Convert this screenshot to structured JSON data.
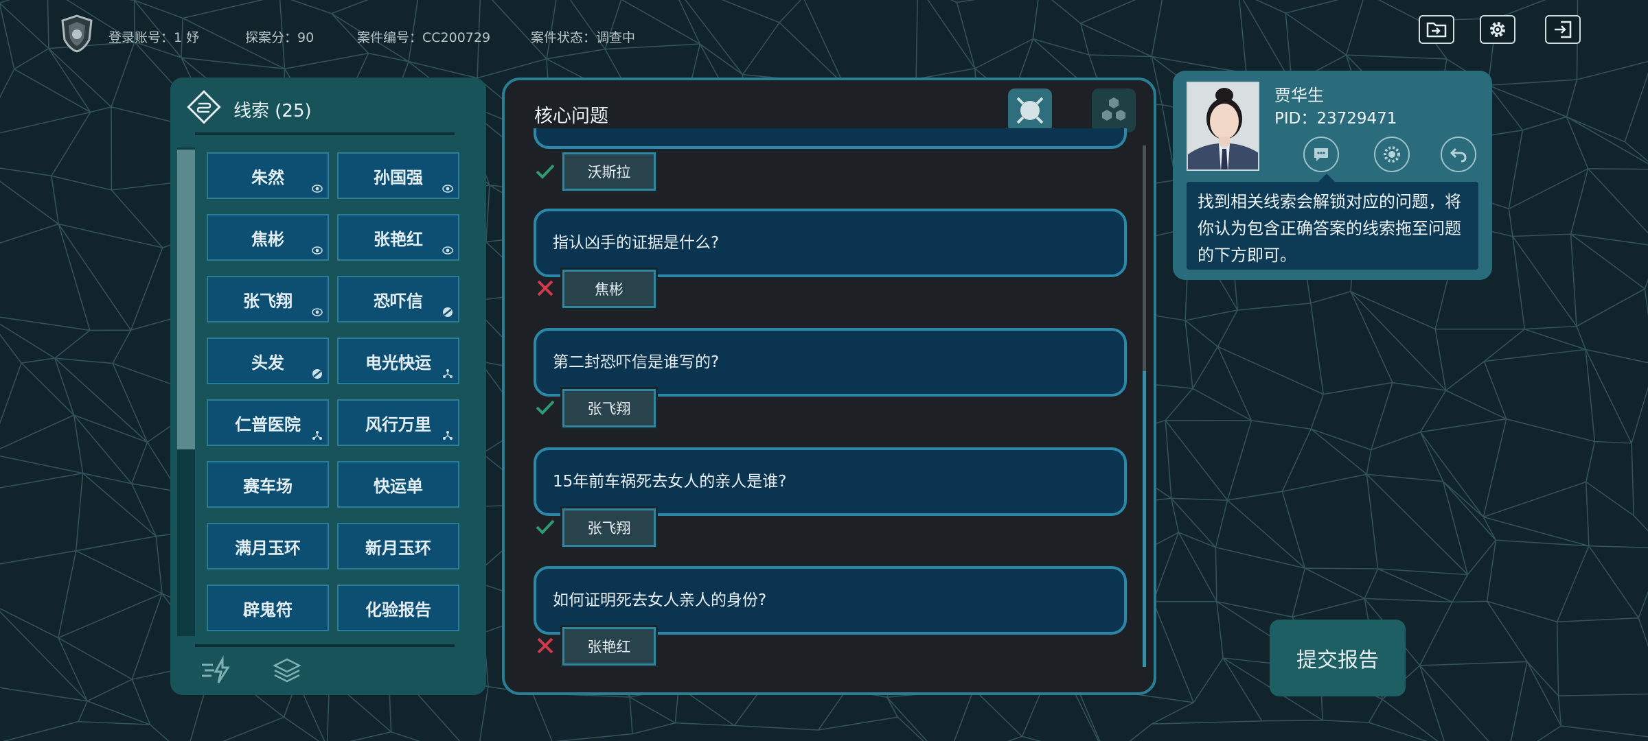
{
  "topbar": {
    "account": "登录账号：1 妤",
    "score": "探案分：90",
    "case_no": "案件编号：CC200729",
    "status": "案件状态：调查中"
  },
  "clues": {
    "title": "线索 (25)",
    "items": [
      {
        "label": "朱然",
        "badge": "eye"
      },
      {
        "label": "孙国强",
        "badge": "eye"
      },
      {
        "label": "焦彬",
        "badge": "eye"
      },
      {
        "label": "张艳红",
        "badge": "eye"
      },
      {
        "label": "张飞翔",
        "badge": "eye"
      },
      {
        "label": "恐吓信",
        "badge": "disc"
      },
      {
        "label": "头发",
        "badge": "disc"
      },
      {
        "label": "电光快运",
        "badge": "network"
      },
      {
        "label": "仁普医院",
        "badge": "network"
      },
      {
        "label": "风行万里",
        "badge": "network"
      },
      {
        "label": "赛车场",
        "badge": ""
      },
      {
        "label": "快运单",
        "badge": ""
      },
      {
        "label": "满月玉环",
        "badge": ""
      },
      {
        "label": "新月玉环",
        "badge": ""
      },
      {
        "label": "辟鬼符",
        "badge": ""
      },
      {
        "label": "化验报告",
        "badge": ""
      }
    ]
  },
  "questions": {
    "title": "核心问题",
    "partial_answer": {
      "answer": "沃斯拉",
      "correct": true
    },
    "items": [
      {
        "question": "指认凶手的证据是什么?",
        "answer": "焦彬",
        "correct": false
      },
      {
        "question": "第二封恐吓信是谁写的?",
        "answer": "张飞翔",
        "correct": true
      },
      {
        "question": "15年前车祸死去女人的亲人是谁?",
        "answer": "张飞翔",
        "correct": true
      },
      {
        "question": "如何证明死去女人亲人的身份?",
        "answer": "张艳红",
        "correct": false
      }
    ]
  },
  "character": {
    "name": "贾华生",
    "pid": "PID：23729471",
    "tip": "找到相关线索会解锁对应的问题，将你认为包含正确答案的线索拖至问题的下方即可。"
  },
  "submit_label": "提交报告",
  "colors": {
    "correct": "#2f9a70",
    "wrong": "#d23a4c",
    "accent": "#2c88a8"
  }
}
